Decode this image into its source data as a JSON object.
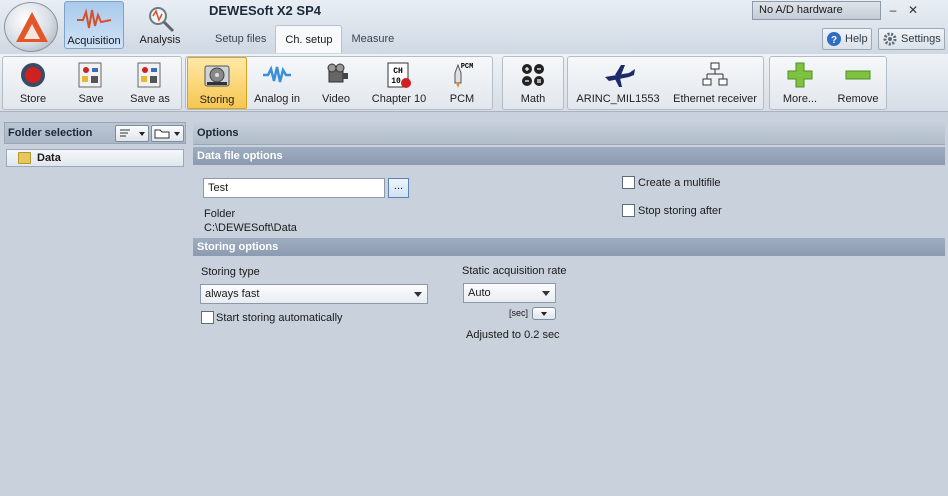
{
  "app": {
    "title": "DEWESoft X2 SP4"
  },
  "modes": [
    {
      "label": "Acquisition",
      "active": true
    },
    {
      "label": "Analysis",
      "active": false
    }
  ],
  "tabs": [
    {
      "label": "Setup files",
      "active": false
    },
    {
      "label": "Ch. setup",
      "active": true
    },
    {
      "label": "Measure",
      "active": false
    }
  ],
  "hardware": {
    "status": "No A/D hardware"
  },
  "window_controls": {
    "minimize": "–",
    "close": "✕"
  },
  "header_links": {
    "help": "Help",
    "settings": "Settings"
  },
  "toolbar": {
    "store": "Store",
    "save": "Save",
    "save_as": "Save as",
    "storing": "Storing",
    "analog_in": "Analog in",
    "video": "Video",
    "chapter10": "Chapter 10",
    "pcm": "PCM",
    "math": "Math",
    "arinc": "ARINC_MIL1553",
    "ethernet": "Ethernet receiver",
    "more": "More...",
    "remove": "Remove",
    "icon_text": {
      "pcm": "PCM",
      "ch_top": "CH",
      "ch_bottom": "10"
    }
  },
  "folder_panel": {
    "title": "Folder selection",
    "items": [
      {
        "label": "Data"
      }
    ]
  },
  "options": {
    "title": "Options",
    "data_file": {
      "heading": "Data file options",
      "file_name": "Test",
      "browse_label": "...",
      "folder_label": "Folder",
      "folder_path": "C:\\DEWESoft\\Data",
      "create_multifile": {
        "label": "Create a multifile",
        "checked": false
      },
      "stop_storing_after": {
        "label": "Stop storing after",
        "checked": false
      }
    },
    "storing": {
      "heading": "Storing options",
      "storing_type_label": "Storing type",
      "storing_type_value": "always fast",
      "start_auto": {
        "label": "Start storing automatically",
        "checked": false
      },
      "static_rate_label": "Static acquisition rate",
      "static_rate_value": "Auto",
      "unit_label": "[sec]",
      "adjusted_text": "Adjusted to 0.2 sec"
    }
  },
  "colors": {
    "accent_active_mode": "#a9c9ec",
    "active_tool": "#f6c650",
    "section_header": "#8b9bb0",
    "background": "#c9d1dc",
    "logo": "#e2562a"
  }
}
